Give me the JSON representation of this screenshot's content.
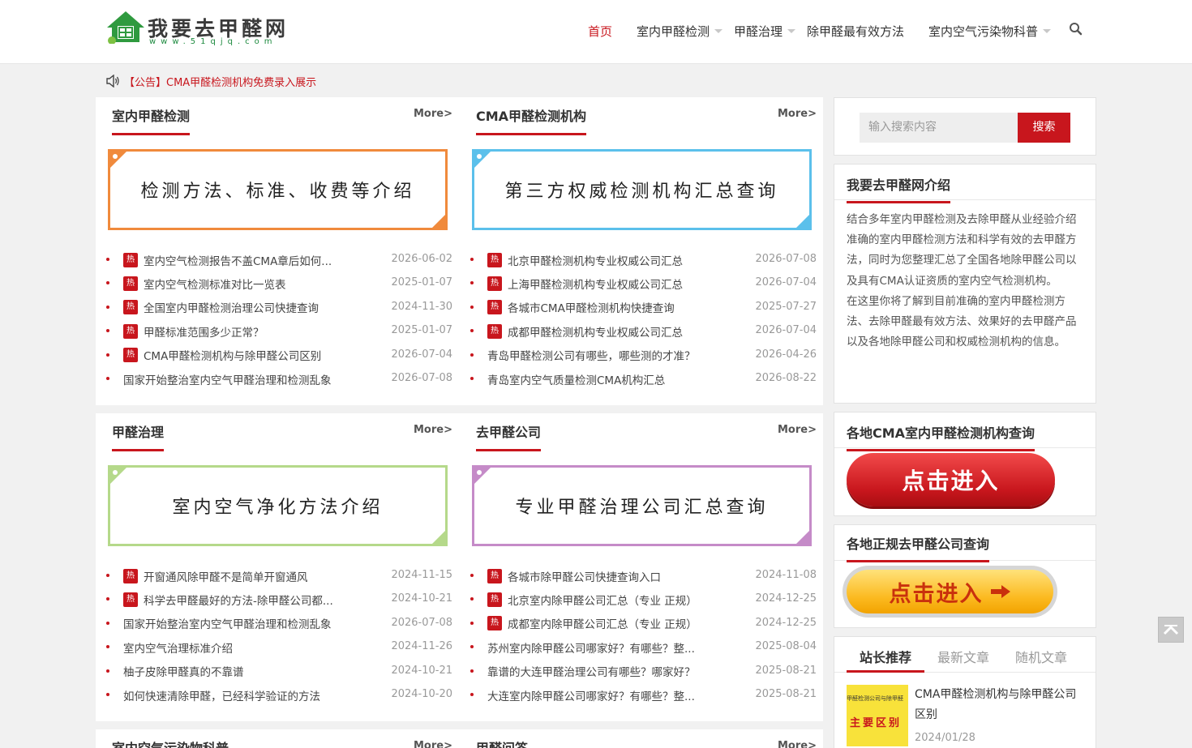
{
  "header": {
    "logo_text": "我要去甲醛网",
    "logo_url": "www.51qjq.com",
    "nav": [
      {
        "label": "首页",
        "active": true,
        "dropdown": false
      },
      {
        "label": "室内甲醛检测",
        "active": false,
        "dropdown": true
      },
      {
        "label": "甲醛治理",
        "active": false,
        "dropdown": true
      },
      {
        "label": "除甲醛最有效方法",
        "active": false,
        "dropdown": false
      },
      {
        "label": "室内空气污染物科普",
        "active": false,
        "dropdown": true
      }
    ]
  },
  "notice": {
    "text": "【公告】CMA甲醛检测机构免费录入展示"
  },
  "sections": [
    {
      "title": "室内甲醛检测",
      "more": "More>",
      "banner": "检测方法、标准、收费等介绍",
      "banner_color": "#f08a3c",
      "items": [
        {
          "hot": true,
          "title": "室内空气检测报告不盖CMA章后如何...",
          "date": "2026-06-02"
        },
        {
          "hot": true,
          "title": "室内空气检测标准对比一览表",
          "date": "2025-01-07"
        },
        {
          "hot": true,
          "title": "全国室内甲醛检测治理公司快捷查询",
          "date": "2024-11-30"
        },
        {
          "hot": true,
          "title": "甲醛标准范围多少正常？",
          "date": "2025-01-07"
        },
        {
          "hot": true,
          "title": "CMA甲醛检测机构与除甲醛公司区别",
          "date": "2026-07-04"
        },
        {
          "hot": false,
          "title": "国家开始整治室内空气甲醛治理和检测乱象",
          "date": "2026-07-08"
        }
      ]
    },
    {
      "title": "CMA甲醛检测机构",
      "more": "More>",
      "banner": "第三方权威检测机构汇总查询",
      "banner_color": "#5bc0eb",
      "items": [
        {
          "hot": true,
          "title": "北京甲醛检测机构专业权威公司汇总",
          "date": "2026-07-08"
        },
        {
          "hot": true,
          "title": "上海甲醛检测机构专业权威公司汇总",
          "date": "2026-07-04"
        },
        {
          "hot": true,
          "title": "各城市CMA甲醛检测机构快捷查询",
          "date": "2025-07-27"
        },
        {
          "hot": true,
          "title": "成都甲醛检测机构专业权威公司汇总",
          "date": "2026-07-04"
        },
        {
          "hot": false,
          "title": "青岛甲醛检测公司有哪些，哪些测的才准？",
          "date": "2026-04-26"
        },
        {
          "hot": false,
          "title": "青岛室内空气质量检测CMA机构汇总",
          "date": "2026-08-22"
        }
      ]
    },
    {
      "title": "甲醛治理",
      "more": "More>",
      "banner": "室内空气净化方法介绍",
      "banner_color": "#b5d98a",
      "items": [
        {
          "hot": true,
          "title": "开窗通风除甲醛不是简单开窗通风",
          "date": "2024-11-15"
        },
        {
          "hot": true,
          "title": "科学去甲醛最好的方法-除甲醛公司都...",
          "date": "2024-10-21"
        },
        {
          "hot": false,
          "title": "国家开始整治室内空气甲醛治理和检测乱象",
          "date": "2026-07-08"
        },
        {
          "hot": false,
          "title": "室内空气治理标准介绍",
          "date": "2024-11-26"
        },
        {
          "hot": false,
          "title": "柚子皮除甲醛真的不靠谱",
          "date": "2024-10-21"
        },
        {
          "hot": false,
          "title": "如何快速清除甲醛，已经科学验证的方法",
          "date": "2024-10-20"
        }
      ]
    },
    {
      "title": "去甲醛公司",
      "more": "More>",
      "banner": "专业甲醛治理公司汇总查询",
      "banner_color": "#c58bc8",
      "items": [
        {
          "hot": true,
          "title": "各城市除甲醛公司快捷查询入口",
          "date": "2024-11-08"
        },
        {
          "hot": true,
          "title": "北京室内除甲醛公司汇总（专业 正规）",
          "date": "2024-12-25"
        },
        {
          "hot": true,
          "title": "成都室内除甲醛公司汇总（专业 正规）",
          "date": "2024-12-25"
        },
        {
          "hot": false,
          "title": "苏州室内除甲醛公司哪家好？有哪些？整...",
          "date": "2025-08-04"
        },
        {
          "hot": false,
          "title": "靠谱的大连甲醛治理公司有哪些？哪家好？",
          "date": "2025-08-21"
        },
        {
          "hot": false,
          "title": "大连室内除甲醛公司哪家好？有哪些？整...",
          "date": "2025-08-21"
        }
      ]
    },
    {
      "title": "室内空气污染物科普",
      "more": "More>"
    },
    {
      "title": "甲醛问答",
      "more": "More>"
    }
  ],
  "hot_label": "热",
  "sidebar": {
    "search": {
      "placeholder": "输入搜索内容",
      "button": "搜索"
    },
    "intro": {
      "title": "我要去甲醛网介绍",
      "p1": "结合多年室内甲醛检测及去除甲醛从业经验介绍准确的室内甲醛检测方法和科学有效的去甲醛方法，同时为您整理汇总了全国各地除甲醛公司以及具有CMA认证资质的室内空气检测机构。",
      "p2": "在这里你将了解到目前准确的室内甲醛检测方法、去除甲醛最有效方法、效果好的去甲醛产品以及各地除甲醛公司和权威检测机构的信息。"
    },
    "cma": {
      "title": "各地CMA室内甲醛检测机构查询",
      "button": "点击进入"
    },
    "company": {
      "title": "各地正规去甲醛公司查询",
      "button": "点击进入"
    },
    "tabs": [
      {
        "label": "站长推荐",
        "active": true
      },
      {
        "label": "最新文章",
        "active": false
      },
      {
        "label": "随机文章",
        "active": false
      }
    ],
    "recommend": {
      "thumb_small": "甲醛检测公司与除甲醛",
      "thumb_big": "主要区别",
      "title": "CMA甲醛检测机构与除甲醛公司区别",
      "date": "2024/01/28"
    }
  },
  "colors": {
    "accent": "#c8161d",
    "link": "#333333",
    "date": "#999999"
  }
}
